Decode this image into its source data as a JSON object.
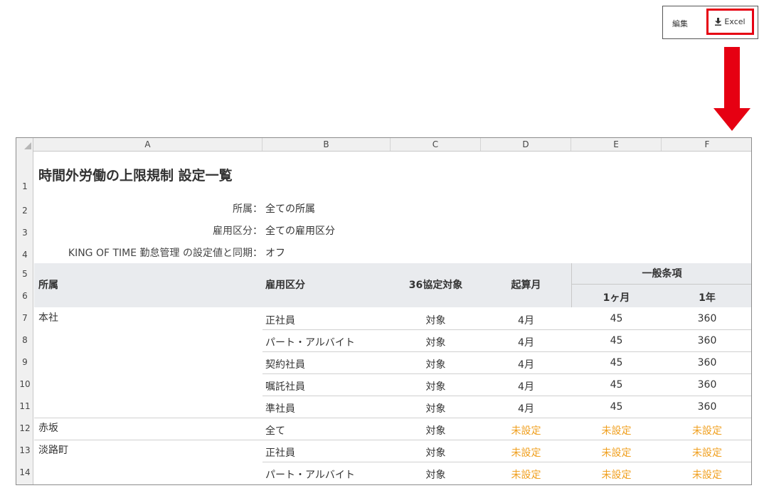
{
  "toolbar": {
    "edit_label": "編集",
    "excel_label": "Excel",
    "accent_color": "#e60012"
  },
  "sheet": {
    "columns": [
      "A",
      "B",
      "C",
      "D",
      "E",
      "F"
    ],
    "rows": [
      "1",
      "2",
      "3",
      "4",
      "5",
      "6",
      "7",
      "8",
      "9",
      "10",
      "11",
      "12",
      "13",
      "14"
    ],
    "title": "時間外労働の上限規制 設定一覧",
    "meta": [
      {
        "label": "所属：",
        "value": "全ての所属"
      },
      {
        "label": "雇用区分：",
        "value": "全ての雇用区分"
      },
      {
        "label": "KING OF TIME 勤怠管理 の設定値と同期：",
        "value": "オフ"
      }
    ],
    "headers": {
      "dept": "所属",
      "employment": "雇用区分",
      "agreement": "36協定対象",
      "start_month": "起算月",
      "general": "一般条項",
      "one_month": "1ヶ月",
      "one_year": "1年"
    },
    "data_rows": [
      {
        "dept": "本社",
        "employment": "正社員",
        "agreement": "対象",
        "start_month": "4月",
        "one_month": "45",
        "one_year": "360"
      },
      {
        "dept": "",
        "employment": "パート・アルバイト",
        "agreement": "対象",
        "start_month": "4月",
        "one_month": "45",
        "one_year": "360"
      },
      {
        "dept": "",
        "employment": "契約社員",
        "agreement": "対象",
        "start_month": "4月",
        "one_month": "45",
        "one_year": "360"
      },
      {
        "dept": "",
        "employment": "嘱託社員",
        "agreement": "対象",
        "start_month": "4月",
        "one_month": "45",
        "one_year": "360"
      },
      {
        "dept": "",
        "employment": "準社員",
        "agreement": "対象",
        "start_month": "4月",
        "one_month": "45",
        "one_year": "360"
      },
      {
        "dept": "赤坂",
        "employment": "全て",
        "agreement": "対象",
        "start_month": "未設定",
        "one_month": "未設定",
        "one_year": "未設定"
      },
      {
        "dept": "淡路町",
        "employment": "正社員",
        "agreement": "対象",
        "start_month": "未設定",
        "one_month": "未設定",
        "one_year": "未設定"
      },
      {
        "dept": "",
        "employment": "パート・アルバイト",
        "agreement": "対象",
        "start_month": "未設定",
        "one_month": "未設定",
        "one_year": "未設定"
      }
    ],
    "unset_color": "#f0a020"
  }
}
